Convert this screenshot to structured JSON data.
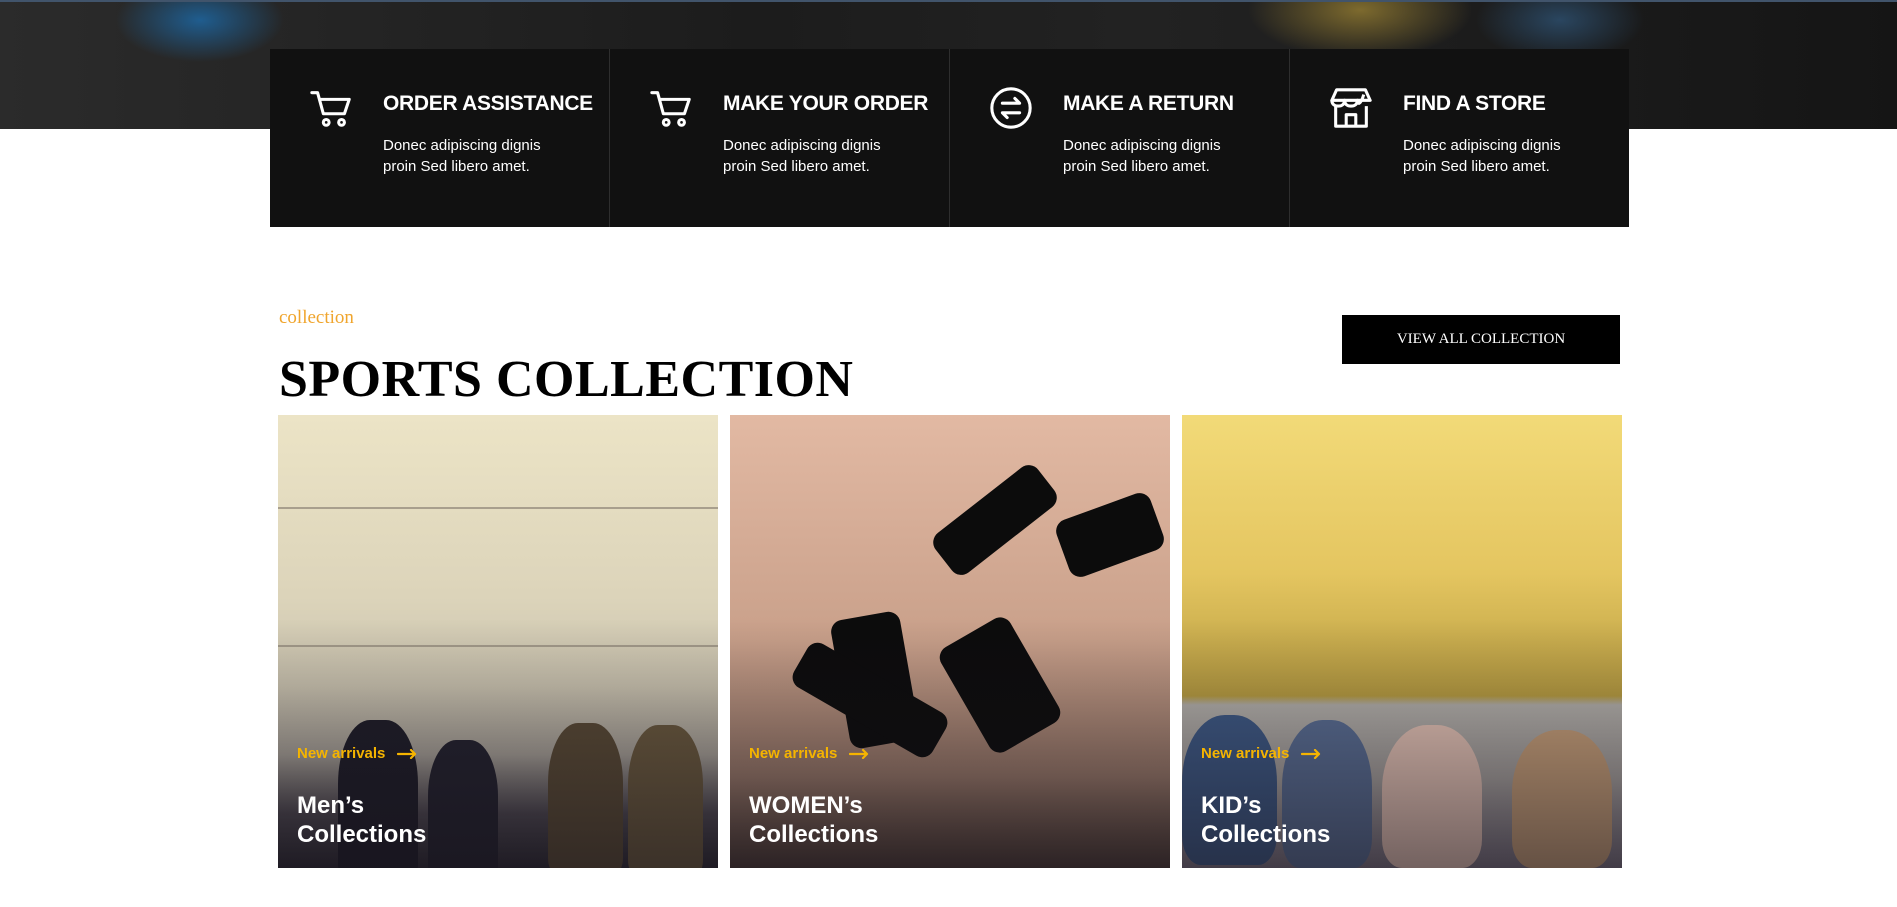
{
  "services": [
    {
      "icon": "cart-icon",
      "title": "ORDER ASSISTANCE",
      "desc": "Donec adipiscing dignis proin Sed libero amet."
    },
    {
      "icon": "cart-icon",
      "title": "MAKE YOUR ORDER",
      "desc": "Donec adipiscing dignis proin Sed libero amet."
    },
    {
      "icon": "return-arrows-icon",
      "title": "MAKE A RETURN",
      "desc": "Donec adipiscing dignis proin Sed libero amet."
    },
    {
      "icon": "store-icon",
      "title": "FIND A STORE",
      "desc": "Donec adipiscing dignis proin Sed libero amet."
    }
  ],
  "collection": {
    "eyebrow": "collection",
    "title": "SPORTS COLLECTION",
    "view_all_label": "VIEW ALL COLLECTION",
    "cards": [
      {
        "tag": "New arrivals",
        "name_line1": "Men’s",
        "name_line2": "Collections"
      },
      {
        "tag": "New arrivals",
        "name_line1": "WOMEN’s",
        "name_line2": "Collections"
      },
      {
        "tag": "New arrivals",
        "name_line1": "KID’s",
        "name_line2": "Collections"
      }
    ]
  },
  "colors": {
    "accent": "#f0a52d",
    "tag": "#f5b400",
    "dark_bar": "#111111"
  }
}
